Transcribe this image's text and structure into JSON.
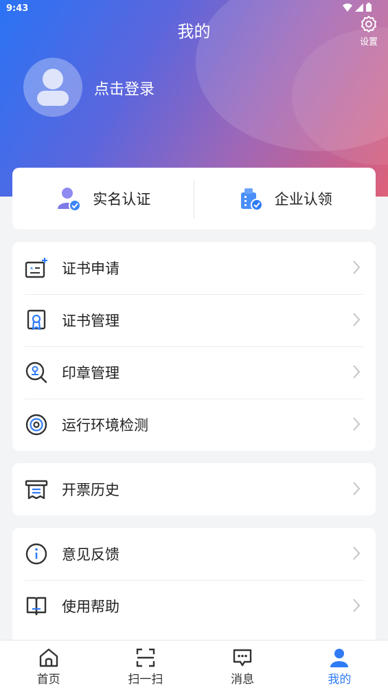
{
  "status": {
    "time": "9:43"
  },
  "header": {
    "title": "我的",
    "settings_label": "设置",
    "login_text": "点击登录"
  },
  "auth": [
    {
      "label": "实名认证",
      "icon": "user-verified-icon"
    },
    {
      "label": "企业认领",
      "icon": "building-verified-icon"
    }
  ],
  "group1": [
    {
      "label": "证书申请",
      "icon": "certificate-add-icon"
    },
    {
      "label": "证书管理",
      "icon": "certificate-badge-icon"
    },
    {
      "label": "印章管理",
      "icon": "seal-search-icon"
    },
    {
      "label": "运行环境检测",
      "icon": "target-icon"
    }
  ],
  "group2": [
    {
      "label": "开票历史",
      "icon": "receipt-icon"
    }
  ],
  "group3": [
    {
      "label": "意见反馈",
      "icon": "info-icon"
    },
    {
      "label": "使用帮助",
      "icon": "book-icon"
    }
  ],
  "nav": [
    {
      "label": "首页",
      "icon": "home-icon"
    },
    {
      "label": "扫一扫",
      "icon": "scan-icon"
    },
    {
      "label": "消息",
      "icon": "message-icon"
    },
    {
      "label": "我的",
      "icon": "user-icon"
    }
  ],
  "colors": {
    "accent": "#2f7bf6",
    "gradient_start": "#2a73f5",
    "gradient_end": "#dd6079"
  }
}
